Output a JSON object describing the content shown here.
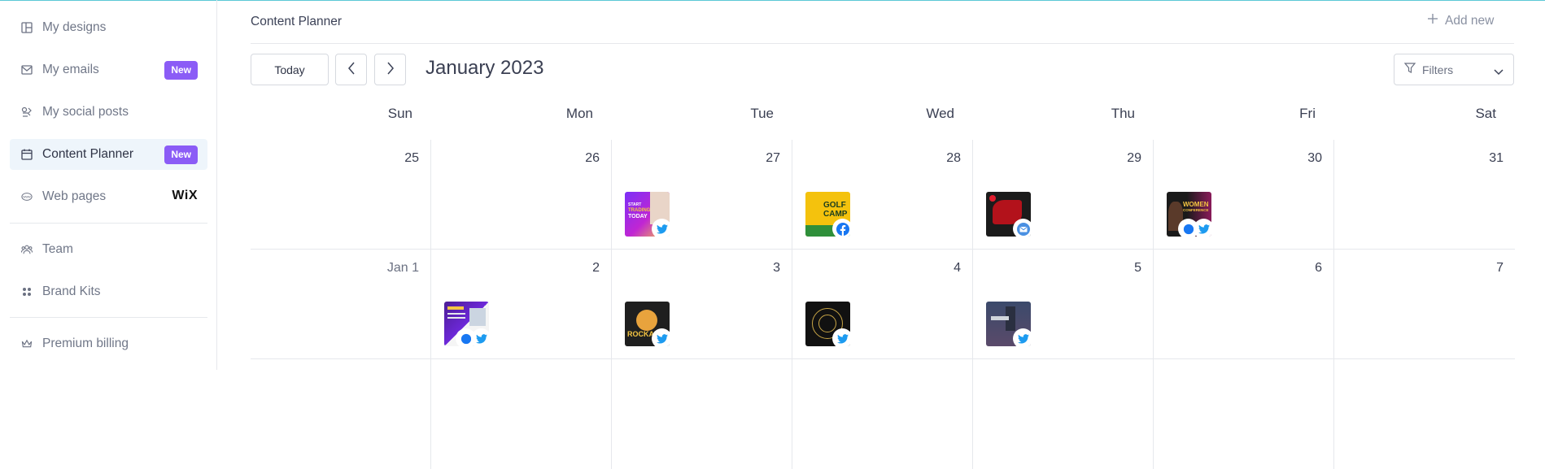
{
  "sidebar": {
    "items": [
      {
        "label": "My designs",
        "icon": "designs-icon"
      },
      {
        "label": "My emails",
        "icon": "mail-icon",
        "badge": "New"
      },
      {
        "label": "My social posts",
        "icon": "social-posts-icon"
      },
      {
        "label": "Content Planner",
        "icon": "calendar-icon",
        "badge": "New",
        "active": true
      },
      {
        "label": "Web pages",
        "icon": "www-icon",
        "brand": "WiX"
      },
      {
        "label": "Team",
        "icon": "team-icon"
      },
      {
        "label": "Brand Kits",
        "icon": "brand-kits-icon"
      },
      {
        "label": "Premium billing",
        "icon": "crown-icon"
      }
    ]
  },
  "header": {
    "title": "Content Planner",
    "add_new": "Add new"
  },
  "toolbar": {
    "today": "Today",
    "month": "January 2023",
    "filters": "Filters"
  },
  "calendar": {
    "weekdays": [
      "Sun",
      "Mon",
      "Tue",
      "Wed",
      "Thu",
      "Fri",
      "Sat"
    ],
    "weeks": [
      {
        "days": [
          {
            "label": "25"
          },
          {
            "label": "26"
          },
          {
            "label": "27",
            "post": {
              "network": "twitter",
              "thumb_text": [
                "START",
                "TRADING",
                "TODAY"
              ]
            }
          },
          {
            "label": "28",
            "post": {
              "network": "facebook",
              "thumb_text": [
                "GOLF",
                "CAMP"
              ]
            }
          },
          {
            "label": "29",
            "post": {
              "network": "email",
              "thumb_text": []
            }
          },
          {
            "label": "30",
            "post": {
              "network": "twitter",
              "thumb_text": [
                "WOMEN",
                "CONFERENCE"
              ]
            }
          },
          {
            "label": "31"
          }
        ]
      },
      {
        "days": [
          {
            "label": "Jan 1"
          },
          {
            "label": "2",
            "post": {
              "network": "twitter",
              "thumb_text": []
            }
          },
          {
            "label": "3",
            "post": {
              "network": "twitter",
              "thumb_text": [
                "ROCKAB"
              ]
            }
          },
          {
            "label": "4",
            "post": {
              "network": "twitter",
              "thumb_text": []
            }
          },
          {
            "label": "5",
            "post": {
              "network": "twitter",
              "thumb_text": []
            }
          },
          {
            "label": "6"
          },
          {
            "label": "7"
          }
        ]
      }
    ]
  },
  "colors": {
    "accent_badge": "#8b5cf6",
    "active_bg": "#eef5fb",
    "twitter": "#1d9bf0",
    "facebook": "#1877f2",
    "email": "#4a90e2"
  }
}
